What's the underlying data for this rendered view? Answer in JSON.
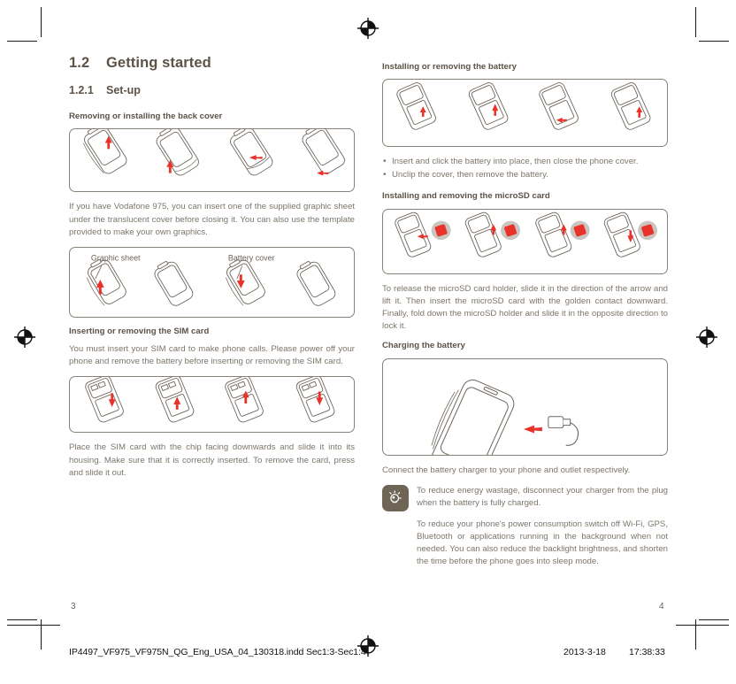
{
  "document": {
    "section": {
      "number": "1.2",
      "title": "Getting started"
    },
    "subsection": {
      "number": "1.2.1",
      "title": "Set-up"
    }
  },
  "left_column": {
    "back_cover": {
      "heading": "Removing or installing the back cover",
      "figure_name": "back-cover-removal-figure",
      "paragraph": "If you have Vodafone 975, you can insert one of the supplied graphic sheet under the translucent cover before closing it. You can also use the template provided to make your own graphics."
    },
    "graphic_sheet": {
      "figure_name": "graphic-sheet-figure",
      "label_left": "Graphic sheet",
      "label_right": "Battery cover"
    },
    "sim": {
      "heading": "Inserting or removing the SIM card",
      "paragraph": "You must insert your SIM card to make phone calls. Please power off your phone and remove the battery before inserting or removing the SIM card.",
      "figure_name": "sim-card-figure",
      "paragraph_after": "Place the SIM card with the chip facing downwards and slide it into its housing. Make sure that it is correctly inserted. To remove the card, press and slide it out."
    }
  },
  "right_column": {
    "battery": {
      "heading": "Installing or removing the battery",
      "figure_name": "battery-figure",
      "bullets": [
        "Insert and click the battery into place, then close the phone cover.",
        "Unclip the cover, then remove the battery."
      ]
    },
    "microsd": {
      "heading": "Installing and removing the microSD card",
      "figure_name": "microsd-figure",
      "paragraph": "To release the microSD card holder, slide it in the direction of the arrow and lift it. Then insert the microSD card with the golden contact downward. Finally, fold down the microSD holder and slide it in the opposite direction to lock it."
    },
    "charging": {
      "heading": "Charging the battery",
      "figure_name": "charging-figure",
      "paragraph": "Connect the battery charger to your phone and outlet respectively.",
      "tip_icon": "lightbulb-tip-icon",
      "tip_text": "To reduce energy wastage, disconnect your charger from the plug when the battery is fully charged.",
      "tip_extra": "To reduce your phone's power consumption switch off Wi-Fi, GPS, Bluetooth or applications running in the background when not needed. You can also reduce the backlight brightness, and shorten the time before the phone goes into sleep mode."
    }
  },
  "page_numbers": {
    "left": "3",
    "right": "4"
  },
  "imprint": {
    "filename": "IP4497_VF975_VF975N_QG_Eng_USA_04_130318.indd   Sec1:3-Sec1:4",
    "date": "2013-3-18",
    "time": "17:38:33"
  },
  "colors": {
    "heading": "#5c5247",
    "body": "#7d756b",
    "figure_border": "#8a8178",
    "arrow_red": "#e8322a",
    "tip_bg": "#6e6557",
    "line_art": "#6d655c"
  }
}
